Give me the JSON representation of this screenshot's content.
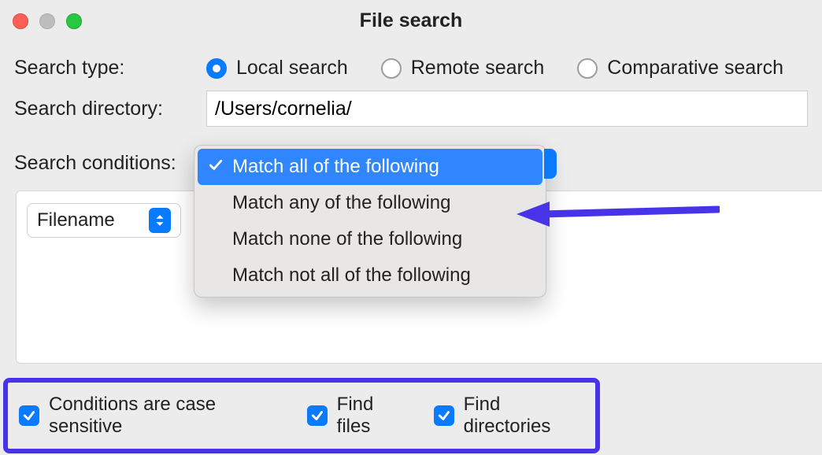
{
  "title": "File search",
  "labels": {
    "search_type": "Search type:",
    "search_directory": "Search directory:",
    "search_conditions": "Search conditions:"
  },
  "search_type": {
    "options": [
      {
        "label": "Local search",
        "checked": true
      },
      {
        "label": "Remote search",
        "checked": false
      },
      {
        "label": "Comparative search",
        "checked": false
      }
    ]
  },
  "directory": "/Users/cornelia/",
  "filter_select": "Filename",
  "conditions_dropdown": {
    "items": [
      {
        "label": "Match all of the following",
        "selected": true
      },
      {
        "label": "Match any of the following",
        "selected": false
      },
      {
        "label": "Match none of the following",
        "selected": false
      },
      {
        "label": "Match not all of the following",
        "selected": false
      }
    ]
  },
  "checkboxes": {
    "case_sensitive": {
      "label": "Conditions are case sensitive",
      "checked": true
    },
    "find_files": {
      "label": "Find files",
      "checked": true
    },
    "find_directories": {
      "label": "Find directories",
      "checked": true
    }
  },
  "annotation": {
    "arrow_color": "#4834e8",
    "highlight_box_color": "#4834e8"
  }
}
